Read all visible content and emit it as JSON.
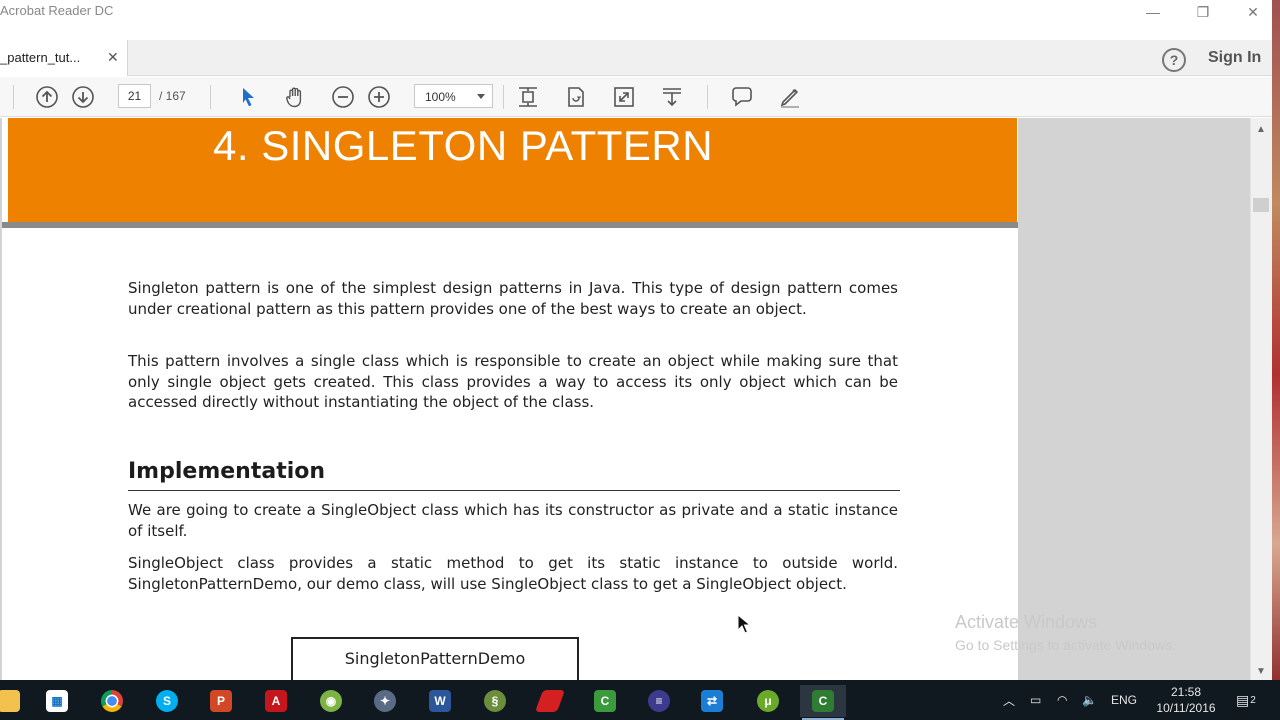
{
  "window": {
    "title": "Acrobat Reader DC",
    "minimize_glyph": "—",
    "restore_glyph": "❐",
    "close_glyph": "✕"
  },
  "tabs": {
    "doc_tab_label": "_pattern_tut...",
    "close_glyph": "✕",
    "help_glyph": "?",
    "sign_in": "Sign In"
  },
  "toolbar": {
    "page_current": "21",
    "page_total": "/  167",
    "zoom": "100%",
    "icons": [
      "prev-page-icon",
      "next-page-icon",
      "select-arrow-icon",
      "hand-tool-icon",
      "zoom-out-icon",
      "zoom-in-icon",
      "fit-page-icon",
      "rotate-icon",
      "fullscreen-icon",
      "scroll-mode-icon",
      "comment-icon",
      "pen-icon"
    ]
  },
  "document": {
    "banner_title": "4.  SINGLETON PATTERN",
    "banner_color": "#ee8100",
    "para1": "Singleton pattern is one of the simplest design patterns in Java. This type of design pattern comes under creational pattern as this pattern provides one of the best ways to create an object.",
    "para2": "This pattern involves a single class which is responsible to create an object while making sure that only single object gets created. This class provides a way to access its only object which can be accessed directly without instantiating the object of the class.",
    "heading": "Implementation",
    "para3": "We are going to create a SingleObject class which has its constructor as private and a static instance of itself.",
    "para4": "SingleObject class provides a static method to get its static instance to outside world. SingletonPatternDemo, our demo class, will use SingleObject class to get a SingleObject object.",
    "uml_class": "SingletonPatternDemo"
  },
  "watermark": {
    "line1": "Activate Windows",
    "line2": "Go to Settings to activate Windows."
  },
  "taskbar": {
    "apps": [
      "file-explorer-icon",
      "store-icon",
      "chrome-icon",
      "skype-icon",
      "powerpoint-icon",
      "acrobat-icon",
      "android-icon",
      "network-tool-icon",
      "word-icon",
      "snake-app-icon",
      "red-app-icon",
      "camtasia-icon",
      "eclipse-icon",
      "remote-icon",
      "torrent-icon",
      "camtasia-recorder-icon"
    ],
    "lang": "ENG",
    "time": "21:58",
    "date": "10/11/2016",
    "notif_count": "2"
  }
}
